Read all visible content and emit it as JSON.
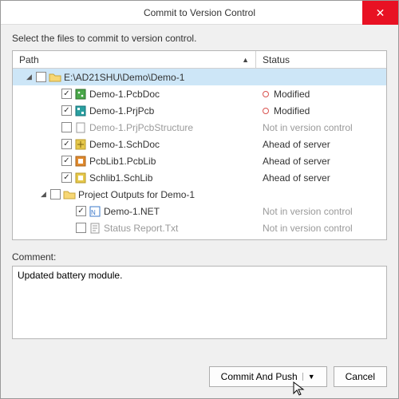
{
  "window": {
    "title": "Commit to Version Control",
    "close_label": "✕"
  },
  "instruction": "Select the files to commit to version control.",
  "columns": {
    "path": "Path",
    "status": "Status",
    "sort_indicator": "▲"
  },
  "tree": {
    "root": {
      "label": "E:\\AD21SHU\\Demo\\Demo-1",
      "expander": "◢"
    },
    "items": [
      {
        "checked": true,
        "icon": "pcbdoc",
        "label": "Demo-1.PcbDoc",
        "status": "Modified",
        "status_kind": "mod",
        "dim": false
      },
      {
        "checked": true,
        "icon": "prjpcb",
        "label": "Demo-1.PrjPcb",
        "status": "Modified",
        "status_kind": "mod",
        "dim": false
      },
      {
        "checked": false,
        "icon": "generic",
        "label": "Demo-1.PrjPcbStructure",
        "status": "Not in version control",
        "status_kind": "nvc",
        "dim": true
      },
      {
        "checked": true,
        "icon": "schdoc",
        "label": "Demo-1.SchDoc",
        "status": "Ahead of server",
        "status_kind": "ahead",
        "dim": false
      },
      {
        "checked": true,
        "icon": "pcblib",
        "label": "PcbLib1.PcbLib",
        "status": "Ahead of server",
        "status_kind": "ahead",
        "dim": false
      },
      {
        "checked": true,
        "icon": "schlib",
        "label": "Schlib1.SchLib",
        "status": "Ahead of server",
        "status_kind": "ahead",
        "dim": false
      }
    ],
    "subfolder": {
      "expander": "◢",
      "label": "Project Outputs for Demo-1",
      "items": [
        {
          "checked": true,
          "icon": "net",
          "label": "Demo-1.NET",
          "status": "Not in version control",
          "status_kind": "nvc",
          "dim": false
        },
        {
          "checked": false,
          "icon": "text",
          "label": "Status Report.Txt",
          "status": "Not in version control",
          "status_kind": "nvc",
          "dim": true
        }
      ]
    }
  },
  "comment": {
    "label": "Comment:",
    "value": "Updated battery module."
  },
  "buttons": {
    "commit_push": "Commit And Push",
    "dropdown_glyph": "▼",
    "cancel": "Cancel"
  },
  "icons": {
    "folder_fill": "#f7d774",
    "folder_stroke": "#c9a63b",
    "pcb_green": "#4aa84a",
    "sch_yellow": "#e6c84b",
    "proj_teal": "#2aa0a0",
    "lib_orange": "#e08a2e",
    "net_blue": "#3b78c9",
    "text_gray": "#9a9a9a"
  }
}
